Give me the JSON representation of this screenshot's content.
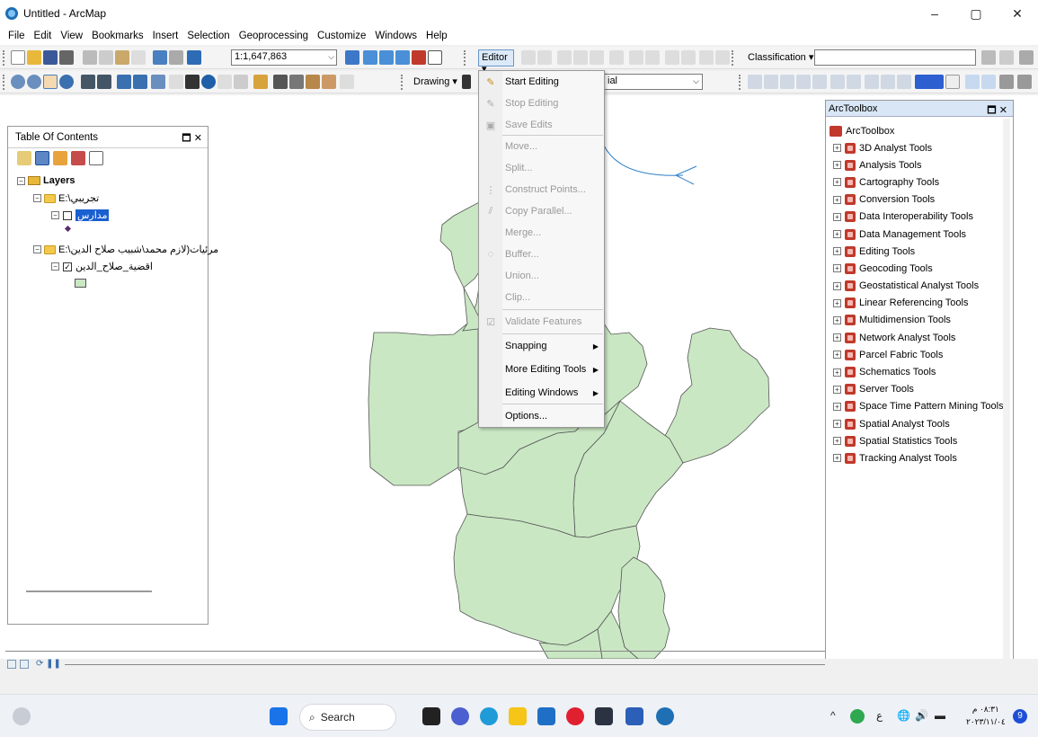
{
  "window": {
    "title": "Untitled - ArcMap",
    "controls": [
      "–",
      "▢",
      "✕"
    ]
  },
  "menu": [
    "File",
    "Edit",
    "View",
    "Bookmarks",
    "Insert",
    "Selection",
    "Geoprocessing",
    "Customize",
    "Windows",
    "Help"
  ],
  "toolbar": {
    "scale": "1:1,647,863",
    "editor_label": "Editor ▾",
    "classification_label": "Classification ▾",
    "drawing_label": "Drawing ▾",
    "font_value": "ial"
  },
  "editor_menu": {
    "items": [
      {
        "label": "Start Editing",
        "enabled": true,
        "icon": "pencil-icon"
      },
      {
        "label": "Stop Editing",
        "enabled": false,
        "icon": "stop-pencil-icon"
      },
      {
        "label": "Save Edits",
        "enabled": false,
        "icon": "save-icon"
      },
      {
        "label": "Move...",
        "enabled": false
      },
      {
        "label": "Split...",
        "enabled": false
      },
      {
        "label": "Construct Points...",
        "enabled": false,
        "icon": "construct-points-icon"
      },
      {
        "label": "Copy Parallel...",
        "enabled": false,
        "icon": "copy-parallel-icon"
      },
      {
        "label": "Merge...",
        "enabled": false
      },
      {
        "label": "Buffer...",
        "enabled": false,
        "icon": "buffer-icon"
      },
      {
        "label": "Union...",
        "enabled": false
      },
      {
        "label": "Clip...",
        "enabled": false
      },
      {
        "label": "Validate Features",
        "enabled": false,
        "icon": "validate-icon"
      },
      {
        "label": "Snapping",
        "enabled": true,
        "submenu": true
      },
      {
        "label": "More Editing Tools",
        "enabled": true,
        "submenu": true
      },
      {
        "label": "Editing Windows",
        "enabled": true,
        "submenu": true
      },
      {
        "label": "Options...",
        "enabled": true
      }
    ]
  },
  "toc": {
    "title": "Table Of Contents",
    "layers_label": "Layers",
    "group1": "E:\\تجريبي",
    "layer1": "مدارس",
    "group2": "E:\\مرئيات(لازم محمد\\شبيب صلاح الدين",
    "layer2": "اقضية_صلاح_الدين"
  },
  "toolbox": {
    "title": "ArcToolbox",
    "root": "ArcToolbox",
    "items": [
      "3D Analyst Tools",
      "Analysis Tools",
      "Cartography Tools",
      "Conversion Tools",
      "Data Interoperability Tools",
      "Data Management Tools",
      "Editing Tools",
      "Geocoding Tools",
      "Geostatistical Analyst Tools",
      "Linear Referencing Tools",
      "Multidimension Tools",
      "Network Analyst Tools",
      "Parcel Fabric Tools",
      "Schematics Tools",
      "Server Tools",
      "Space Time Pattern Mining Tools",
      "Spatial Analyst Tools",
      "Spatial Statistics Tools",
      "Tracking Analyst Tools"
    ]
  },
  "taskbar": {
    "search": "Search",
    "time": "٠٨:٣١ م",
    "date": "٢٠٢٣/١١/٠٤",
    "notif_count": "9",
    "lang": "ع"
  },
  "colors": {
    "map_fill": "#c9e7c3",
    "map_stroke": "#555555",
    "annotation_arrow": "#2f80c9"
  }
}
